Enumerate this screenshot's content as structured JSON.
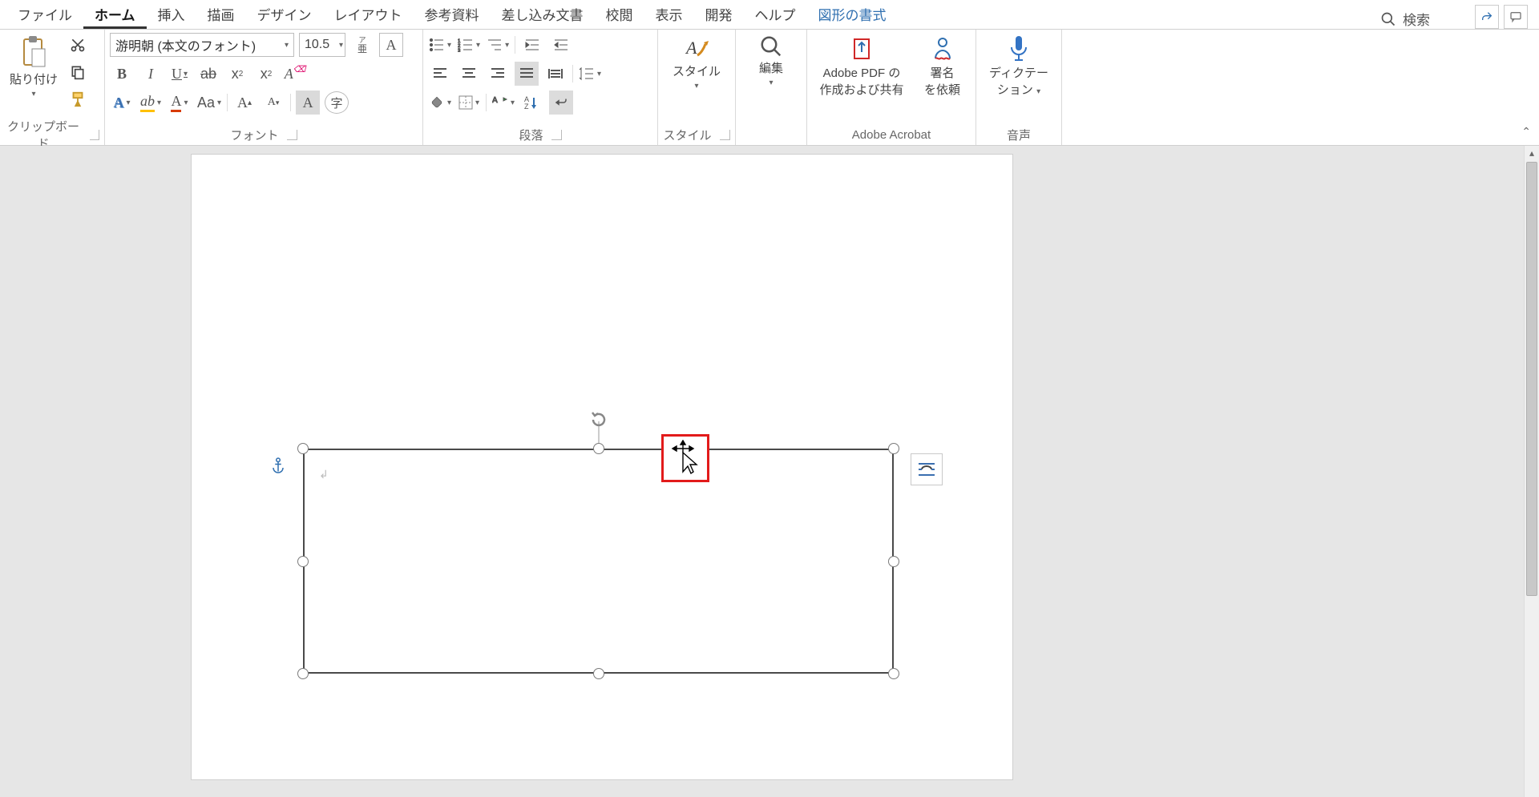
{
  "tabs": {
    "file": "ファイル",
    "home": "ホーム",
    "insert": "挿入",
    "draw": "描画",
    "design": "デザイン",
    "layout": "レイアウト",
    "references": "参考資料",
    "mailings": "差し込み文書",
    "review": "校閲",
    "view": "表示",
    "developer": "開発",
    "help": "ヘルプ",
    "shapefmt": "図形の書式"
  },
  "search": {
    "label": "検索"
  },
  "groups": {
    "clipboard": {
      "label": "クリップボード",
      "paste": "貼り付け"
    },
    "font": {
      "label": "フォント",
      "name": "游明朝 (本文のフォント)",
      "size": "10.5",
      "aa": "Aa"
    },
    "paragraph": {
      "label": "段落"
    },
    "styles": {
      "label": "スタイル",
      "btn": "スタイル"
    },
    "editing": {
      "label": "",
      "btn": "編集"
    },
    "acrobat": {
      "label": "Adobe Acrobat",
      "pdf1": "Adobe PDF の",
      "pdf2": "作成および共有",
      "sig1": "署名",
      "sig2": "を依頼"
    },
    "voice": {
      "label": "音声",
      "btn1": "ディクテー",
      "btn2": "ション"
    }
  }
}
